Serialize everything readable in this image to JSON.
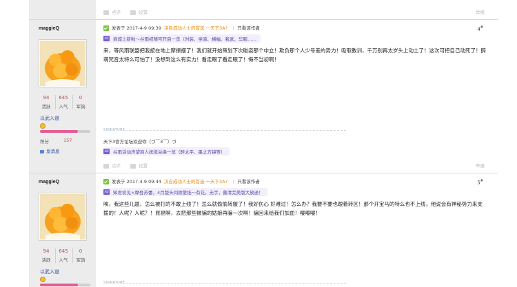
{
  "top_actions": {
    "support": "点评",
    "oppose": "设置",
    "report": "举报"
  },
  "posts": [
    {
      "user": "maggieQ",
      "stats": [
        {
          "value": "94",
          "label": "活跃"
        },
        {
          "value": "645",
          "label": "人气"
        },
        {
          "value": "0",
          "label": "军饷"
        }
      ],
      "rank": "以武入道",
      "level_progress": 0.75,
      "credit_label": "积分",
      "credit_value": "157",
      "send_message": "发消息",
      "posted_prefix": "发表于 2017-4-9 09:39",
      "promo": "决自成功人士的首选 一天下3A?",
      "only_author": "只看该作者",
      "floor": "4",
      "floor_sup": "#",
      "ad": "商城上新啦～谷雨初晴可开启一览（时装、坐骑、横幅、我武、华服……",
      "body": "来，等风雨联盟把我按在地上摩擦摆了！我们就开始策划下次碰姿那个中立！欺负那个人少号差的势力！吸取教训，千万别再太岁头上动土了！这次可把自己动死了！醉萌梵音太特么可怕了！没想到这么有实力！看走眼了看走眼了！悔不当初啊！",
      "signature_label": "SIGNATURE",
      "signature": "天下3官方论坛欢迎你（づ￣3￣）づ",
      "ad2": "谷雨活动声望商人抚揽兑换一览（醉太平、墨之方镜等）",
      "actions": {
        "support": "点评",
        "oppose": "设置",
        "report": "举报"
      }
    },
    {
      "user": "maggieQ",
      "stats": [
        {
          "value": "94",
          "label": "活跃"
        },
        {
          "value": "645",
          "label": "人气"
        },
        {
          "value": "0",
          "label": "军饷"
        }
      ],
      "rank": "以武入道",
      "level_progress": 0.75,
      "posted_prefix": "发表于 2017-4-9 09:44",
      "promo": "决自成功人士的首选 一天下3A?",
      "only_author": "只看该作者",
      "floor": "5",
      "floor_sup": "#",
      "ad": "知君初见×摩登苏蕾，4月版头同款壁纸～有花，无宇，蔷清完美版大放送！",
      "body": "唉，我这些儿题，怎么被打的不敢上线了！怎么就偷偷转服了！我好伤心 好难过！怎么办？我要不要也跟着转区！那个开宝马的特么也不上线，他说会有神秘势力来支援的！人呢？人呢？！昆昆啊，去把那些被骗的姑娘再骗一次啊！骗回来给我们加血！嘤嘤嘤！",
      "signature_label": "SIGNATURE"
    }
  ]
}
